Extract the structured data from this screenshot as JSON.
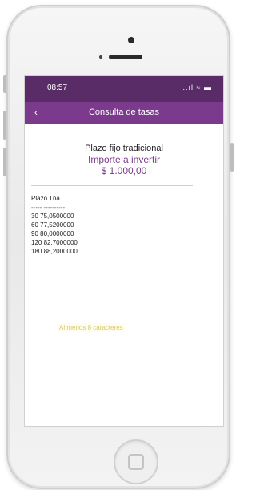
{
  "status_bar": {
    "time": "08:57",
    "icons": "..ıl ≈ ▬"
  },
  "nav": {
    "back_label": "‹",
    "title": "Consulta de tasas"
  },
  "header": {
    "title": "Plazo fijo tradicional",
    "subtitle": "Importe a invertir",
    "amount": "$ 1.000,00"
  },
  "table": {
    "header": "Plazo Tna",
    "separator": "----- ----------",
    "rows": [
      "30 75,0500000",
      "60 77,5200000",
      "90 80,0000000",
      "120 82,7000000",
      "180 88,2000000"
    ]
  },
  "hint": {
    "text": "Al menos 8 caracteres"
  },
  "colors": {
    "statusbar": "#5a2c67",
    "navbar": "#7b3a8b",
    "accent": "#7b3a8b"
  }
}
